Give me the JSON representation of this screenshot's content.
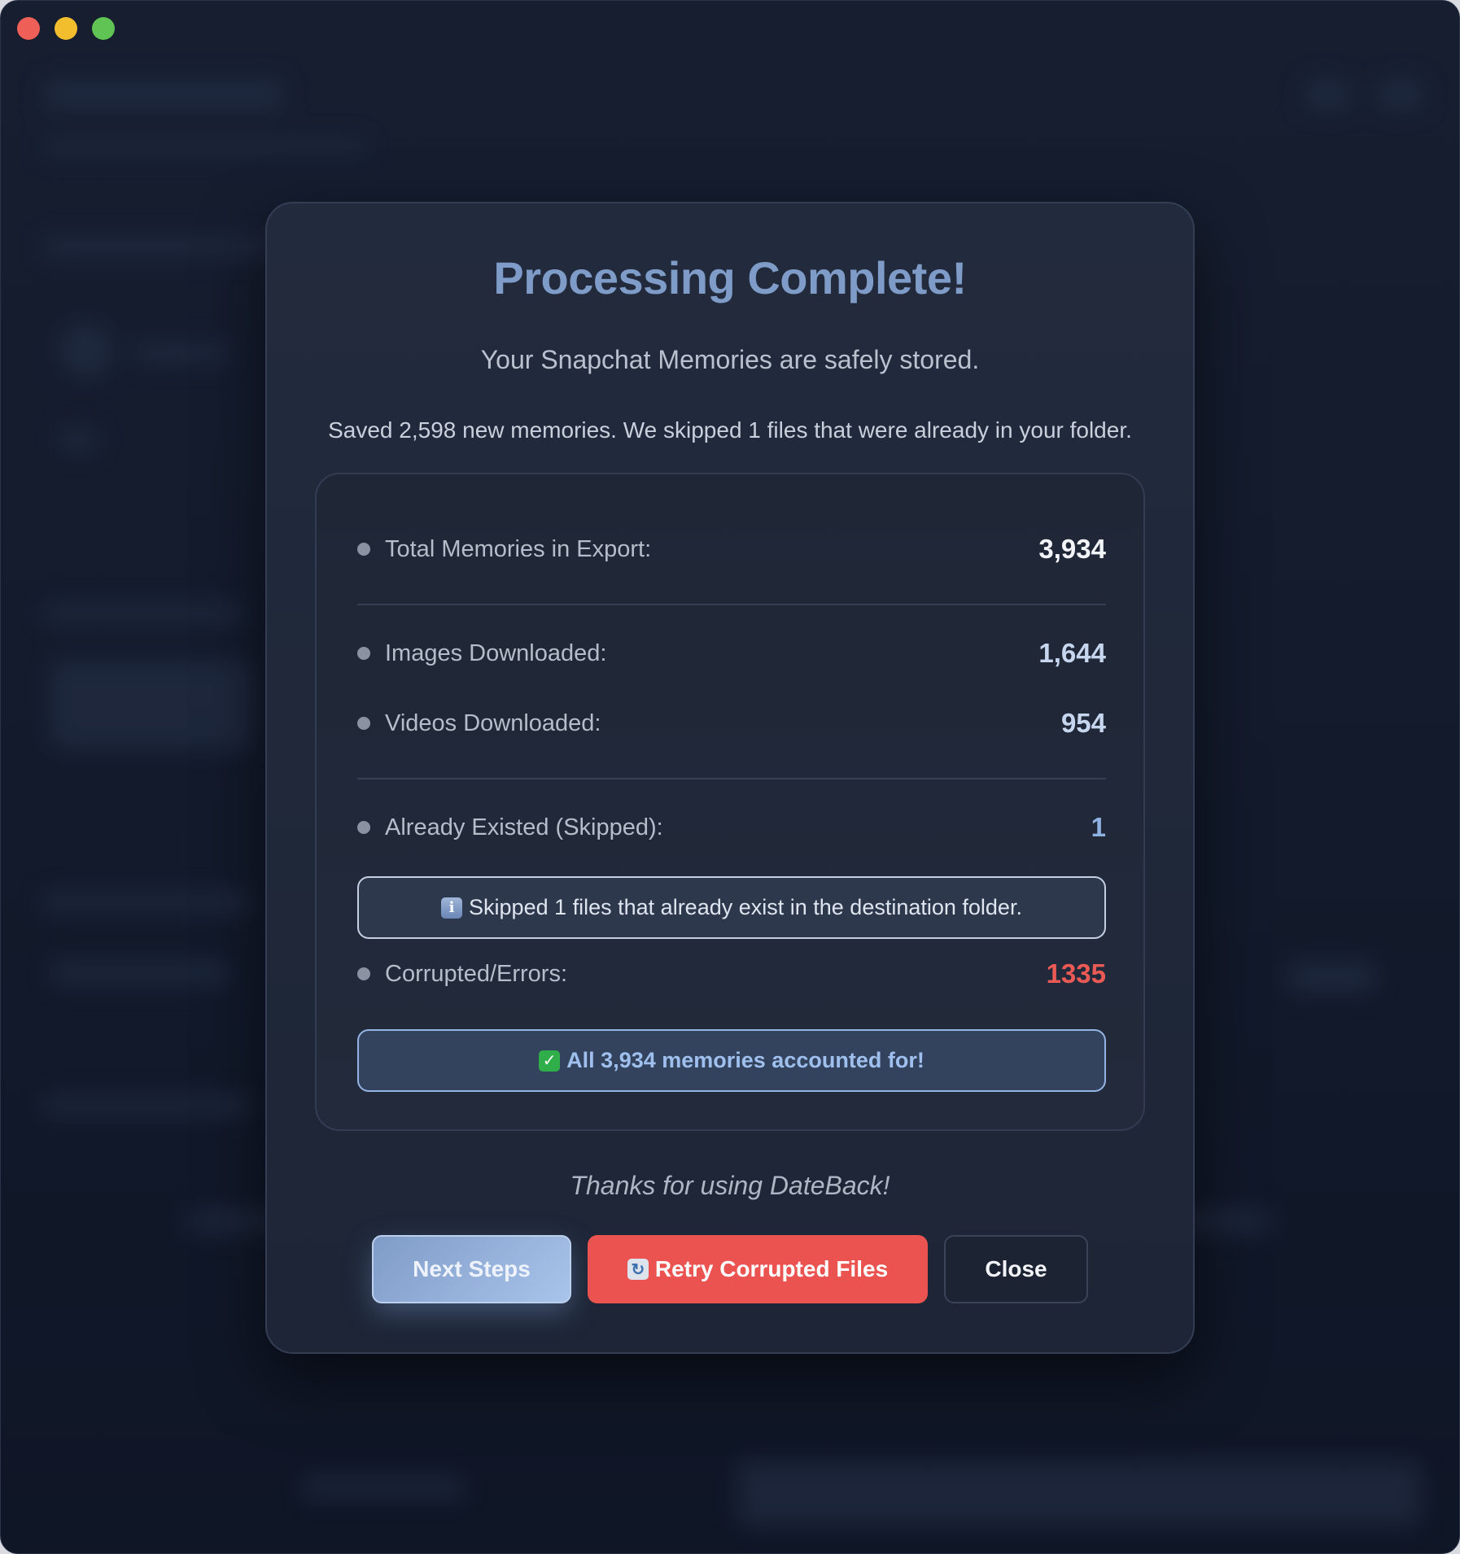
{
  "dialog": {
    "title": "Processing Complete!",
    "subtitle": "Your Snapchat Memories are safely stored.",
    "summary": "Saved 2,598 new memories. We skipped 1 files that were already in your folder."
  },
  "stats": {
    "total": {
      "label": "Total Memories in Export:",
      "value": "3,934"
    },
    "images": {
      "label": "Images Downloaded:",
      "value": "1,644"
    },
    "videos": {
      "label": "Videos Downloaded:",
      "value": "954"
    },
    "skipped": {
      "label": "Already Existed (Skipped):",
      "value": "1"
    },
    "skipped_notice": "Skipped 1 files that already exist in the destination folder.",
    "errors": {
      "label": "Corrupted/Errors:",
      "value": "1335"
    },
    "accounted_notice": "All 3,934 memories accounted for!"
  },
  "thanks": "Thanks for using DateBack!",
  "buttons": {
    "next_steps": "Next Steps",
    "retry": "Retry Corrupted Files",
    "close": "Close"
  },
  "icons": {
    "info": "info-icon",
    "check": "check-icon",
    "retry": "retry-icon"
  },
  "colors": {
    "accent": "#7f9cc8",
    "error": "#eb5a54",
    "retry_button": "#eb5350",
    "success_check": "#2fae4a"
  }
}
